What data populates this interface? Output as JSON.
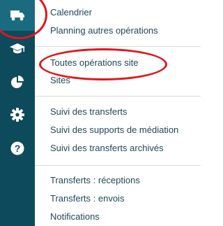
{
  "sidebar": {
    "background": "#0d4a5c",
    "active_background": "#1a6b80",
    "icons": [
      "truck-icon",
      "graduation-cap-icon",
      "pie-chart-icon",
      "gear-icon",
      "question-icon"
    ]
  },
  "menu": {
    "group1": [
      "Calendrier",
      "Planning autres opérations"
    ],
    "group2": [
      "Toutes opérations site",
      "Sites"
    ],
    "group3": [
      "Suivi des transferts",
      "Suivi des supports de médiation",
      "Suivi des transferts archivés"
    ],
    "group4": [
      "Transferts : réceptions",
      "Transferts : envois",
      "Notifications"
    ]
  },
  "colors": {
    "text": "#1f4756",
    "annotation": "#e0161b"
  }
}
